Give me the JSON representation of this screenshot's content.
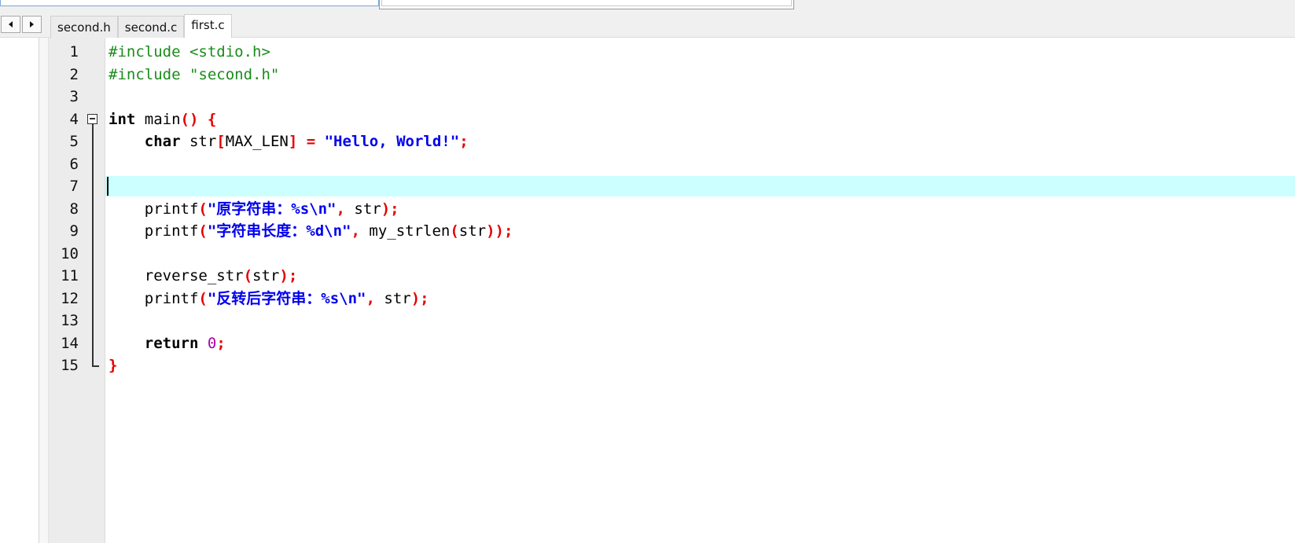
{
  "tabs": [
    {
      "label": "second.h",
      "active": false
    },
    {
      "label": "second.c",
      "active": false
    },
    {
      "label": "first.c",
      "active": true
    }
  ],
  "editor": {
    "current_line": 7,
    "lines": [
      {
        "n": "1",
        "tokens": [
          {
            "t": "#include <stdio.h>",
            "c": "pp"
          }
        ]
      },
      {
        "n": "2",
        "tokens": [
          {
            "t": "#include \"second.h\"",
            "c": "pp"
          }
        ]
      },
      {
        "n": "3",
        "tokens": []
      },
      {
        "n": "4",
        "fold": "start",
        "tokens": [
          {
            "t": "int",
            "c": "kw"
          },
          {
            "t": " main",
            "c": "id"
          },
          {
            "t": "() {",
            "c": "op"
          }
        ]
      },
      {
        "n": "5",
        "fold": "mid",
        "tokens": [
          {
            "t": "    ",
            "c": "id"
          },
          {
            "t": "char",
            "c": "kw"
          },
          {
            "t": " str",
            "c": "id"
          },
          {
            "t": "[",
            "c": "op"
          },
          {
            "t": "MAX_LEN",
            "c": "id"
          },
          {
            "t": "] = ",
            "c": "op"
          },
          {
            "t": "\"Hello, World!\"",
            "c": "str"
          },
          {
            "t": ";",
            "c": "op"
          }
        ]
      },
      {
        "n": "6",
        "fold": "mid",
        "tokens": []
      },
      {
        "n": "7",
        "fold": "mid",
        "tokens": []
      },
      {
        "n": "8",
        "fold": "mid",
        "tokens": [
          {
            "t": "    printf",
            "c": "id"
          },
          {
            "t": "(",
            "c": "op"
          },
          {
            "t": "\"原字符串：%s\\n\"",
            "c": "str"
          },
          {
            "t": ", ",
            "c": "op"
          },
          {
            "t": "str",
            "c": "id"
          },
          {
            "t": ");",
            "c": "op"
          }
        ]
      },
      {
        "n": "9",
        "fold": "mid",
        "tokens": [
          {
            "t": "    printf",
            "c": "id"
          },
          {
            "t": "(",
            "c": "op"
          },
          {
            "t": "\"字符串长度：%d\\n\"",
            "c": "str"
          },
          {
            "t": ", ",
            "c": "op"
          },
          {
            "t": "my_strlen",
            "c": "id"
          },
          {
            "t": "(",
            "c": "op"
          },
          {
            "t": "str",
            "c": "id"
          },
          {
            "t": "));",
            "c": "op"
          }
        ]
      },
      {
        "n": "10",
        "fold": "mid",
        "tokens": []
      },
      {
        "n": "11",
        "fold": "mid",
        "tokens": [
          {
            "t": "    reverse_str",
            "c": "id"
          },
          {
            "t": "(",
            "c": "op"
          },
          {
            "t": "str",
            "c": "id"
          },
          {
            "t": ");",
            "c": "op"
          }
        ]
      },
      {
        "n": "12",
        "fold": "mid",
        "tokens": [
          {
            "t": "    printf",
            "c": "id"
          },
          {
            "t": "(",
            "c": "op"
          },
          {
            "t": "\"反转后字符串：%s\\n\"",
            "c": "str"
          },
          {
            "t": ", ",
            "c": "op"
          },
          {
            "t": "str",
            "c": "id"
          },
          {
            "t": ");",
            "c": "op"
          }
        ]
      },
      {
        "n": "13",
        "fold": "mid",
        "tokens": []
      },
      {
        "n": "14",
        "fold": "mid",
        "tokens": [
          {
            "t": "    ",
            "c": "id"
          },
          {
            "t": "return",
            "c": "kw"
          },
          {
            "t": " ",
            "c": "id"
          },
          {
            "t": "0",
            "c": "num"
          },
          {
            "t": ";",
            "c": "op"
          }
        ]
      },
      {
        "n": "15",
        "fold": "end",
        "tokens": [
          {
            "t": "}",
            "c": "op"
          }
        ]
      }
    ]
  }
}
